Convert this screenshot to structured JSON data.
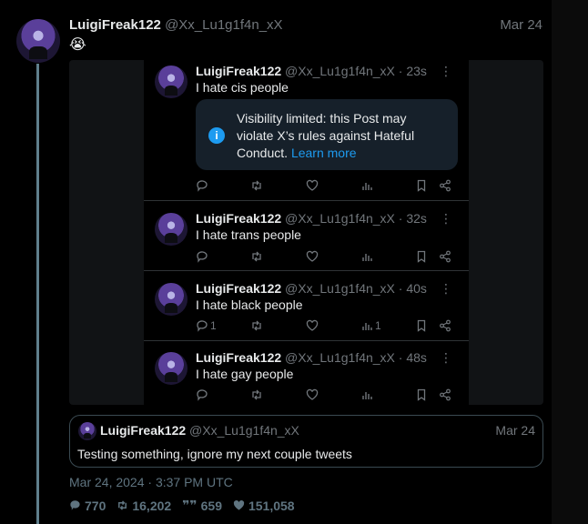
{
  "post": {
    "name": "LuigiFreak122",
    "handle": "@Xx_Lu1g1f4n_xX",
    "date": "Mar 24",
    "emoji": "😭",
    "timestamp": "Mar 24, 2024 · 3:37 PM UTC"
  },
  "screenshot": {
    "tweets": [
      {
        "name": "LuigiFreak122",
        "meta": "@Xx_Lu1g1f4n_xX · 23s",
        "text": "I hate cis people",
        "notice": {
          "text": "Visibility limited: this Post may violate X’s rules against Hateful Conduct.",
          "link": "Learn more"
        },
        "replies": "",
        "views": ""
      },
      {
        "name": "LuigiFreak122",
        "meta": "@Xx_Lu1g1f4n_xX · 32s",
        "text": "I hate trans people",
        "replies": "",
        "views": ""
      },
      {
        "name": "LuigiFreak122",
        "meta": "@Xx_Lu1g1f4n_xX · 40s",
        "text": "I hate black people",
        "replies": "1",
        "views": "1"
      },
      {
        "name": "LuigiFreak122",
        "meta": "@Xx_Lu1g1f4n_xX · 48s",
        "text": "I hate gay people",
        "replies": "",
        "views": ""
      }
    ]
  },
  "quote": {
    "name": "LuigiFreak122",
    "handle": "@Xx_Lu1g1f4n_xX",
    "date": "Mar 24",
    "text": "Testing something, ignore my next couple tweets"
  },
  "stats": {
    "replies": "770",
    "reposts": "16,202",
    "quotes": "659",
    "likes": "151,058"
  },
  "colors": {
    "accent": "#1d9bf0",
    "muted": "#71767b",
    "notice_bg": "#16202a"
  }
}
